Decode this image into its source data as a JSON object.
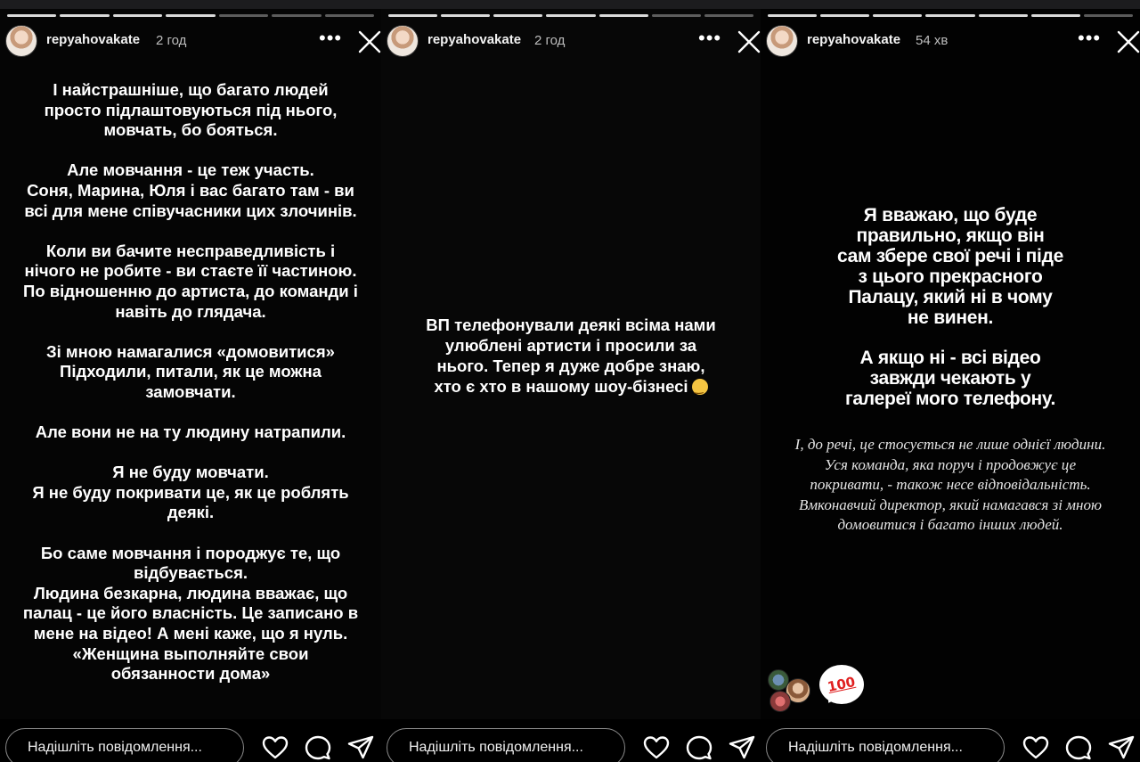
{
  "panels": [
    {
      "username": "repyahovakate",
      "time": "2 год",
      "text": "І найстрашніше, що багато людей\nпросто підлаштовуються під нього,\nмовчать, бо бояться.\n\nАле мовчання - це теж участь.\nСоня, Марина, Юля і вас багато там - ви\nвсі для мене співучасники цих злочинів.\n\nКоли ви бачите несправедливість і\nнічого не робите - ви стаєте її частиною.\nПо відношенню до артиста, до команди і\nнавіть до глядача.\n\nЗі мною намагалися «домовитися»\nПідходили, питали, як це можна\nзамовчати.\n\nАле вони не на ту людину натрапили.\n\nЯ не буду мовчати.\nЯ не буду покривати це, як це роблять\nдеякі.\n\nБо саме мовчання і породжує те, що\nвідбувається.\nЛюдина безкарна, людина вважає, що\nпалац - це його власність. Це записано в\nмене на відео! А мені каже, що я нуль.\n«Женщина выполняйте свои\nобязанности дома»",
      "message_placeholder": "Надішліть повідомлення..."
    },
    {
      "username": "repyahovakate",
      "time": "2 год",
      "text": "ВП телефонували деякі всіма нами\nулюблені артисти і просили за\nнього. Тепер я дуже добре знаю,\nхто є хто в нашому шоу-бізнесі",
      "message_placeholder": "Надішліть повідомлення..."
    },
    {
      "username": "repyahovakate",
      "time": "54 хв",
      "text_main": "Я вважаю, що буде\nправильно, якщо він\nсам збере свої речі і піде\nз цього прекрасного\nПалацу, який ні в чому\nне винен.",
      "text_second": "А якщо ні - всі відео\nзавжди чекають у\nгалереї мого телефону.",
      "text_italic": "І, до речі, це стосується не лише однієї людини.\nУся команда, яка поруч і продовжує це\nпокривати, - також несе відповідальність.\nВмконавчий директор, який намагався зі мною\nдомовитися і багато інших людей.",
      "sticker": "100",
      "message_placeholder": "Надішліть повідомлення..."
    }
  ],
  "icons": {
    "more": "more-horizontal-icon",
    "close": "close-icon",
    "like": "heart-icon",
    "comment": "comment-bubble-icon",
    "share": "paper-plane-icon"
  },
  "colors": {
    "background": "#000000",
    "text": "#ffffff",
    "muted": "#bdbdbd",
    "input_border": "#8a8a8a",
    "sticker_red": "#e02020"
  }
}
